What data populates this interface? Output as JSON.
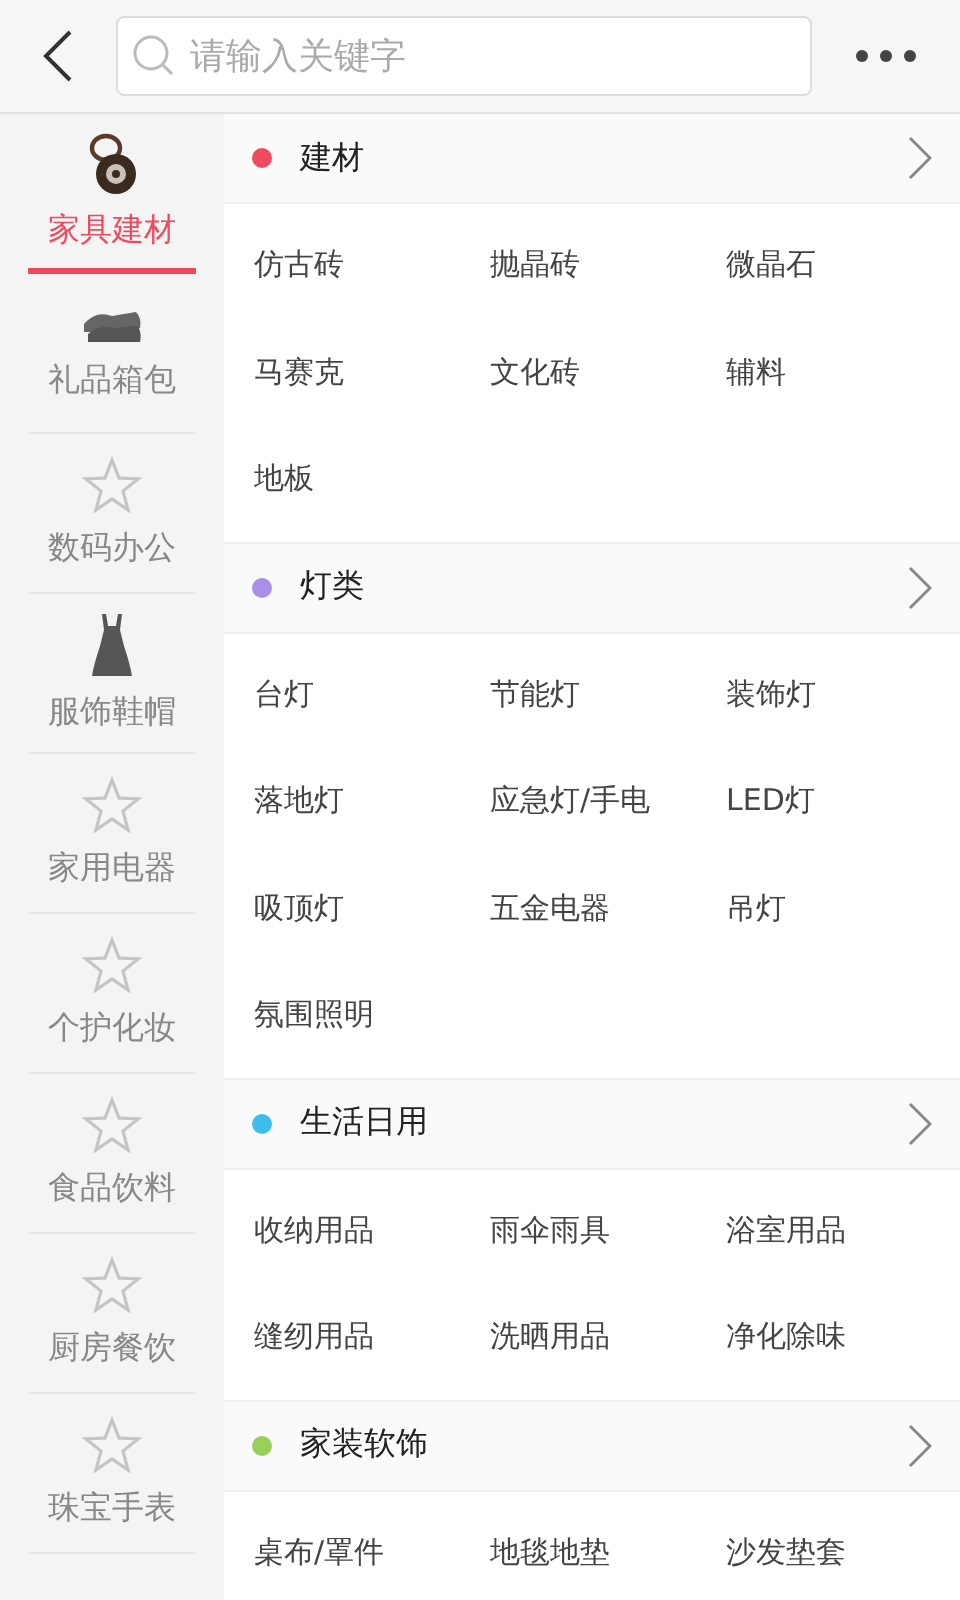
{
  "search": {
    "placeholder": "请输入关键字"
  },
  "sidebar": {
    "items": [
      {
        "label": "家具建材",
        "kind": "compact",
        "selected": true
      },
      {
        "label": "礼品箱包",
        "kind": "shoe",
        "selected": false
      },
      {
        "label": "数码办公",
        "kind": "star",
        "selected": false
      },
      {
        "label": "服饰鞋帽",
        "kind": "dress",
        "selected": false
      },
      {
        "label": "家用电器",
        "kind": "star",
        "selected": false
      },
      {
        "label": "个护化妆",
        "kind": "star",
        "selected": false
      },
      {
        "label": "食品饮料",
        "kind": "star",
        "selected": false
      },
      {
        "label": "厨房餐饮",
        "kind": "star",
        "selected": false
      },
      {
        "label": "珠宝手表",
        "kind": "star",
        "selected": false
      }
    ]
  },
  "sections": [
    {
      "title": "建材",
      "color": "#ef4a5d",
      "items": [
        "仿古砖",
        "抛晶砖",
        "微晶石",
        "马赛克",
        "文化砖",
        "辅料",
        "地板"
      ]
    },
    {
      "title": "灯类",
      "color": "#a98fe8",
      "items": [
        "台灯",
        "节能灯",
        "装饰灯",
        "落地灯",
        "应急灯/手电",
        "LED灯",
        "吸顶灯",
        "五金电器",
        "吊灯",
        "氛围照明"
      ]
    },
    {
      "title": "生活日用",
      "color": "#3fbdea",
      "items": [
        "收纳用品",
        "雨伞雨具",
        "浴室用品",
        "缝纫用品",
        "洗晒用品",
        "净化除味"
      ]
    },
    {
      "title": "家装软饰",
      "color": "#99d05a",
      "items": [
        "桌布/罩件",
        "地毯地垫",
        "沙发垫套"
      ]
    }
  ]
}
